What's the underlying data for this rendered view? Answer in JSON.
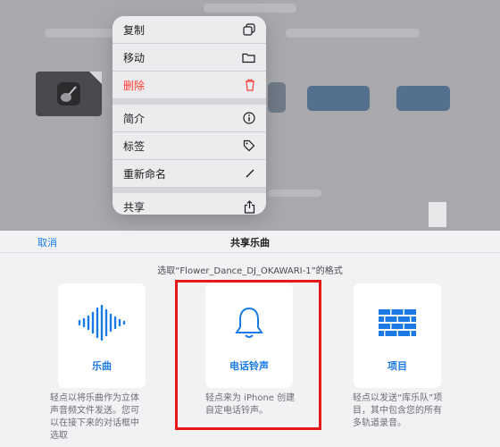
{
  "context_menu": {
    "items": [
      {
        "label": "复制",
        "icon": "copy-icon"
      },
      {
        "label": "移动",
        "icon": "folder-icon"
      },
      {
        "label": "删除",
        "icon": "trash-icon",
        "color": "#ff3b30"
      },
      {
        "label": "简介",
        "icon": "info-icon"
      },
      {
        "label": "标签",
        "icon": "tag-icon"
      },
      {
        "label": "重新命名",
        "icon": "pencil-icon"
      },
      {
        "label": "共享",
        "icon": "share-icon"
      }
    ]
  },
  "share_sheet": {
    "cancel_label": "取消",
    "title": "共享乐曲",
    "subtitle": "选取“Flower_Dance_DJ_OKAWARI-1”的格式",
    "options": [
      {
        "label": "乐曲",
        "icon": "waveform-icon",
        "description": "轻点以将乐曲作为立体声音频文件发送。您可以在接下来的对话框中选取"
      },
      {
        "label": "电话铃声",
        "icon": "bell-icon",
        "description": "轻点来为 iPhone 创建自定电话铃声。"
      },
      {
        "label": "项目",
        "icon": "brick-wall-icon",
        "description": "轻点以发送“库乐队”项目，其中包含您的所有多轨道录音。"
      }
    ]
  },
  "colors": {
    "accent": "#1a7ae8",
    "danger": "#ff3b30",
    "highlight": "#e51919"
  }
}
